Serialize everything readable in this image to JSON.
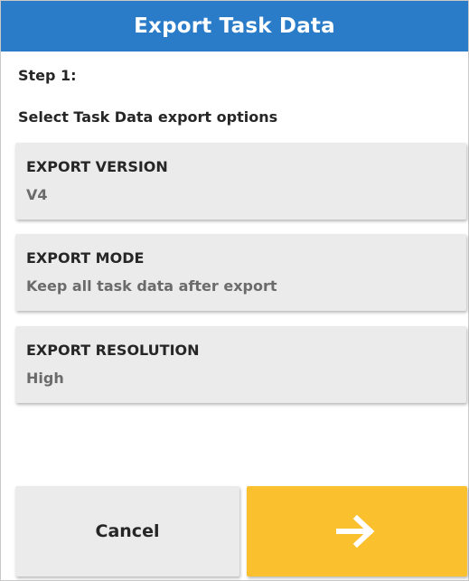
{
  "dialog": {
    "title": "Export Task Data",
    "step_label": "Step 1:",
    "instruction": "Select Task Data export options"
  },
  "options": [
    {
      "title": "EXPORT VERSION",
      "value": "V4"
    },
    {
      "title": "EXPORT MODE",
      "value": "Keep all task data after export"
    },
    {
      "title": "EXPORT RESOLUTION",
      "value": "High"
    }
  ],
  "buttons": {
    "cancel_label": "Cancel",
    "next_icon": "arrow-right-icon"
  },
  "colors": {
    "title_bar": "#2a7bc8",
    "next_button": "#fbc02d",
    "option_background": "#ebebeb"
  }
}
